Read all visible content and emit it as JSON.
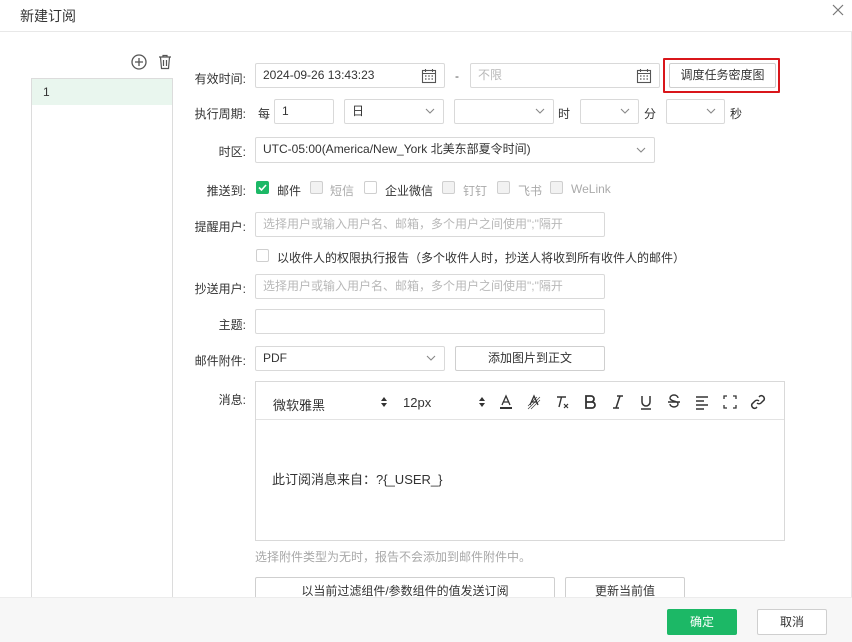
{
  "dialog": {
    "title": "新建订阅"
  },
  "list": {
    "items": [
      "1"
    ]
  },
  "form": {
    "valid_time": {
      "label": "有效时间:",
      "start": "2024-09-26 13:43:23",
      "separator": "-",
      "end_placeholder": "不限",
      "schedule_button": "调度任务密度图"
    },
    "period": {
      "label": "执行周期:",
      "every": "每",
      "count": "1",
      "unit": "日",
      "hour_label": "时",
      "minute_label": "分",
      "second_label": "秒"
    },
    "timezone": {
      "label": "时区:",
      "value": "UTC-05:00(America/New_York 北美东部夏令时间)"
    },
    "push_to": {
      "label": "推送到:",
      "options": [
        {
          "label": "邮件",
          "checked": true
        },
        {
          "label": "短信",
          "checked": false
        },
        {
          "label": "企业微信",
          "checked": false
        },
        {
          "label": "钉钉",
          "checked": false
        },
        {
          "label": "飞书",
          "checked": false
        },
        {
          "label": "WeLink",
          "checked": false
        }
      ]
    },
    "remind_user": {
      "label": "提醒用户:",
      "placeholder": "选择用户或输入用户名、邮箱，多个用户之间使用\";\"隔开"
    },
    "permission_option": {
      "label": "以收件人的权限执行报告（多个收件人时，抄送人将收到所有收件人的邮件）"
    },
    "cc_user": {
      "label": "抄送用户:",
      "placeholder": "选择用户或输入用户名、邮箱，多个用户之间使用\";\"隔开"
    },
    "subject": {
      "label": "主题:",
      "value": ""
    },
    "attachment": {
      "label": "邮件附件:",
      "value": "PDF",
      "add_image_button": "添加图片到正文"
    },
    "message": {
      "label": "消息:",
      "font_family": "微软雅黑",
      "font_size": "12px",
      "body": "此订阅消息来自：?{_USER_}"
    },
    "hint": "选择附件类型为无时，报告不会添加到邮件附件中。",
    "send_button": "以当前过滤组件/参数组件的值发送订阅",
    "update_button": "更新当前值"
  },
  "footer": {
    "ok": "确定",
    "cancel": "取消"
  },
  "colors": {
    "accent": "#1cb866",
    "highlight": "#d9161b"
  }
}
